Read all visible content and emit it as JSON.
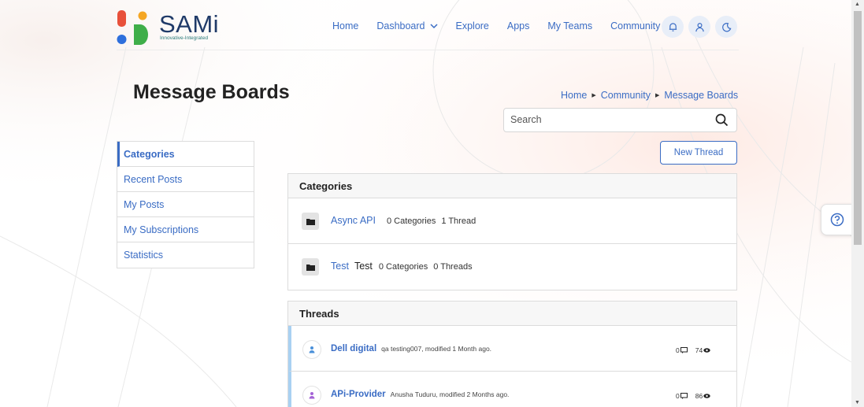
{
  "brand": {
    "name": "SAMi",
    "tagline": "Innovative-Integrated"
  },
  "nav": {
    "items": [
      {
        "label": "Home"
      },
      {
        "label": "Dashboard"
      },
      {
        "label": "Explore"
      },
      {
        "label": "Apps"
      },
      {
        "label": "My Teams"
      },
      {
        "label": "Community"
      }
    ],
    "icons": [
      "bell-icon",
      "user-icon",
      "moon-icon"
    ]
  },
  "page": {
    "title": "Message Boards"
  },
  "breadcrumb": [
    "Home",
    "Community",
    "Message Boards"
  ],
  "search": {
    "placeholder": "Search"
  },
  "actions": {
    "new_thread": "New Thread"
  },
  "sidebar": {
    "items": [
      {
        "label": "Categories",
        "active": true
      },
      {
        "label": "Recent Posts"
      },
      {
        "label": "My Posts"
      },
      {
        "label": "My Subscriptions"
      },
      {
        "label": "Statistics"
      }
    ]
  },
  "categories": {
    "heading": "Categories",
    "rows": [
      {
        "name": "Async API",
        "description": "",
        "categories": "0 Categories",
        "threads": "1 Thread"
      },
      {
        "name": "Test",
        "description": "Test",
        "categories": "0 Categories",
        "threads": "0 Threads"
      }
    ]
  },
  "threads": {
    "heading": "Threads",
    "rows": [
      {
        "title": "Dell digital",
        "meta": "qa testing007, modified 1 Month ago.",
        "replies": "0",
        "views": "74",
        "avatar_color": "#4a90d9"
      },
      {
        "title": "APi-Provider",
        "meta": "Anusha Tuduru, modified 2 Months ago.",
        "replies": "0",
        "views": "86",
        "avatar_color": "#a463d6"
      }
    ]
  },
  "colors": {
    "accent": "#3a6cc4",
    "logo_red": "#e8503a",
    "logo_orange": "#f5a623",
    "logo_blue": "#2e6fdc",
    "logo_green": "#3fae49"
  }
}
